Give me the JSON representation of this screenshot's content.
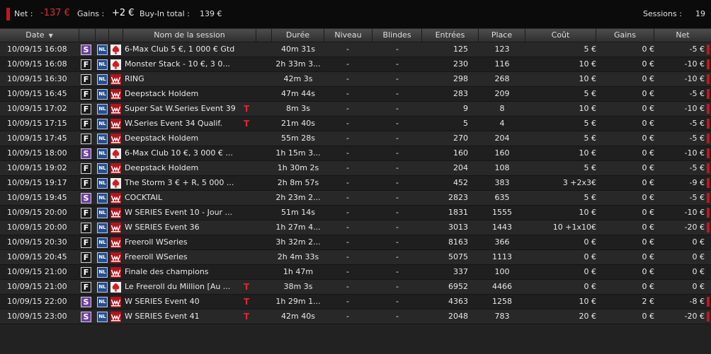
{
  "summary": {
    "net_label": "Net :",
    "net_value": "-137 €",
    "gains_label": "Gains :",
    "gains_value": "+2 €",
    "buyin_label": "Buy-In total :",
    "buyin_value": "139 €",
    "sessions_label": "Sessions :",
    "sessions_value": "19"
  },
  "colors": {
    "accent": "#c3161c",
    "negative": "#e12b2b",
    "badge_s": "#6e3fa0",
    "badge_nl": "#274f8e"
  },
  "columns": {
    "date": "Date",
    "name": "Nom de la session",
    "duration": "Durée",
    "level": "Niveau",
    "blinds": "Blindes",
    "entries": "Entrées",
    "place": "Place",
    "cost": "Coût",
    "gains": "Gains",
    "net": "Net"
  },
  "rows": [
    {
      "date": "10/09/15 16:08",
      "type": "S",
      "limit": "NL",
      "room": "pokerstars-icon",
      "name": "6-Max Club 5 €, 1 000 € Gtd",
      "turbo": "",
      "duration": "40m 31s",
      "level": "-",
      "blinds": "-",
      "entries": "125",
      "place": "123",
      "cost": "5 €",
      "gains": "0 €",
      "net": "-5 €",
      "net_bar": true
    },
    {
      "date": "10/09/15 16:08",
      "type": "F",
      "limit": "NL",
      "room": "pokerstars-icon",
      "name": "Monster Stack - 10 €, 3 0...",
      "turbo": "",
      "duration": "2h 33m 3...",
      "level": "-",
      "blinds": "-",
      "entries": "230",
      "place": "116",
      "cost": "10 €",
      "gains": "0 €",
      "net": "-10 €",
      "net_bar": true
    },
    {
      "date": "10/09/15 16:30",
      "type": "F",
      "limit": "NL",
      "room": "winamax-icon",
      "name": "RING",
      "turbo": "",
      "duration": "42m 3s",
      "level": "-",
      "blinds": "-",
      "entries": "298",
      "place": "268",
      "cost": "10 €",
      "gains": "0 €",
      "net": "-10 €",
      "net_bar": true
    },
    {
      "date": "10/09/15 16:45",
      "type": "F",
      "limit": "NL",
      "room": "winamax-icon",
      "name": "Deepstack Holdem",
      "turbo": "",
      "duration": "47m 44s",
      "level": "-",
      "blinds": "-",
      "entries": "283",
      "place": "209",
      "cost": "5 €",
      "gains": "0 €",
      "net": "-5 €",
      "net_bar": true
    },
    {
      "date": "10/09/15 17:02",
      "type": "F",
      "limit": "NL",
      "room": "winamax-icon",
      "name": "Super Sat W.Series Event 39",
      "turbo": "T",
      "duration": "8m 3s",
      "level": "-",
      "blinds": "-",
      "entries": "9",
      "place": "8",
      "cost": "10 €",
      "gains": "0 €",
      "net": "-10 €",
      "net_bar": true
    },
    {
      "date": "10/09/15 17:15",
      "type": "F",
      "limit": "NL",
      "room": "winamax-icon",
      "name": "W.Series Event 34 Qualif.",
      "turbo": "T",
      "duration": "21m 40s",
      "level": "-",
      "blinds": "-",
      "entries": "5",
      "place": "4",
      "cost": "5 €",
      "gains": "0 €",
      "net": "-5 €",
      "net_bar": true
    },
    {
      "date": "10/09/15 17:45",
      "type": "F",
      "limit": "NL",
      "room": "winamax-icon",
      "name": "Deepstack Holdem",
      "turbo": "",
      "duration": "55m 28s",
      "level": "-",
      "blinds": "-",
      "entries": "270",
      "place": "204",
      "cost": "5 €",
      "gains": "0 €",
      "net": "-5 €",
      "net_bar": true
    },
    {
      "date": "10/09/15 18:00",
      "type": "S",
      "limit": "NL",
      "room": "pokerstars-icon",
      "name": "6-Max Club 10 €, 3 000 € ...",
      "turbo": "",
      "duration": "1h 15m 3...",
      "level": "-",
      "blinds": "-",
      "entries": "160",
      "place": "160",
      "cost": "10 €",
      "gains": "0 €",
      "net": "-10 €",
      "net_bar": true
    },
    {
      "date": "10/09/15 19:02",
      "type": "F",
      "limit": "NL",
      "room": "winamax-icon",
      "name": "Deepstack Holdem",
      "turbo": "",
      "duration": "1h 30m 2s",
      "level": "-",
      "blinds": "-",
      "entries": "204",
      "place": "108",
      "cost": "5 €",
      "gains": "0 €",
      "net": "-5 €",
      "net_bar": true
    },
    {
      "date": "10/09/15 19:17",
      "type": "F",
      "limit": "NL",
      "room": "pokerstars-icon",
      "name": "The Storm 3 € + R, 5 000 ...",
      "turbo": "",
      "duration": "2h 8m 57s",
      "level": "-",
      "blinds": "-",
      "entries": "452",
      "place": "383",
      "cost": "3  +2x3€",
      "gains": "0 €",
      "net": "-9 €",
      "net_bar": true
    },
    {
      "date": "10/09/15 19:45",
      "type": "S",
      "limit": "NL",
      "room": "winamax-icon",
      "name": "COCKTAIL",
      "turbo": "",
      "duration": "2h 23m 2...",
      "level": "-",
      "blinds": "-",
      "entries": "2823",
      "place": "635",
      "cost": "5 €",
      "gains": "0 €",
      "net": "-5 €",
      "net_bar": true
    },
    {
      "date": "10/09/15 20:00",
      "type": "F",
      "limit": "NL",
      "room": "winamax-icon",
      "name": "W SERIES Event 10 - Jour ...",
      "turbo": "",
      "duration": "51m 14s",
      "level": "-",
      "blinds": "-",
      "entries": "1831",
      "place": "1555",
      "cost": "10 €",
      "gains": "0 €",
      "net": "-10 €",
      "net_bar": true
    },
    {
      "date": "10/09/15 20:00",
      "type": "F",
      "limit": "NL",
      "room": "winamax-icon",
      "name": "W SERIES Event 36",
      "turbo": "",
      "duration": "1h 27m 4...",
      "level": "-",
      "blinds": "-",
      "entries": "3013",
      "place": "1443",
      "cost": "10  +1x10€",
      "gains": "0 €",
      "net": "-20 €",
      "net_bar": true
    },
    {
      "date": "10/09/15 20:30",
      "type": "F",
      "limit": "NL",
      "room": "winamax-icon",
      "name": "Freeroll WSeries",
      "turbo": "",
      "duration": "3h 32m 2...",
      "level": "-",
      "blinds": "-",
      "entries": "8163",
      "place": "366",
      "cost": "0 €",
      "gains": "0 €",
      "net": "0 €",
      "net_bar": false
    },
    {
      "date": "10/09/15 20:45",
      "type": "F",
      "limit": "NL",
      "room": "winamax-icon",
      "name": "Freeroll WSeries",
      "turbo": "",
      "duration": "2h 4m 33s",
      "level": "-",
      "blinds": "-",
      "entries": "5075",
      "place": "1113",
      "cost": "0 €",
      "gains": "0 €",
      "net": "0 €",
      "net_bar": false
    },
    {
      "date": "10/09/15 21:00",
      "type": "F",
      "limit": "NL",
      "room": "winamax-icon",
      "name": "Finale des champions",
      "turbo": "",
      "duration": "1h 47m",
      "level": "-",
      "blinds": "-",
      "entries": "337",
      "place": "100",
      "cost": "0 €",
      "gains": "0 €",
      "net": "0 €",
      "net_bar": false
    },
    {
      "date": "10/09/15 21:00",
      "type": "F",
      "limit": "NL",
      "room": "pokerstars-icon",
      "name": "Le Freeroll du Million [Au ...",
      "turbo": "T",
      "duration": "38m 3s",
      "level": "-",
      "blinds": "-",
      "entries": "6952",
      "place": "4466",
      "cost": "0 €",
      "gains": "0 €",
      "net": "0 €",
      "net_bar": false
    },
    {
      "date": "10/09/15 22:00",
      "type": "S",
      "limit": "NL",
      "room": "winamax-icon",
      "name": "W SERIES Event 40",
      "turbo": "T",
      "duration": "1h 29m 1...",
      "level": "-",
      "blinds": "-",
      "entries": "4363",
      "place": "1258",
      "cost": "10 €",
      "gains": "2 €",
      "net": "-8 €",
      "net_bar": true
    },
    {
      "date": "10/09/15 23:00",
      "type": "S",
      "limit": "NL",
      "room": "winamax-icon",
      "name": "W SERIES Event 41",
      "turbo": "T",
      "duration": "42m 40s",
      "level": "-",
      "blinds": "-",
      "entries": "2048",
      "place": "783",
      "cost": "20 €",
      "gains": "0 €",
      "net": "-20 €",
      "net_bar": true
    }
  ]
}
